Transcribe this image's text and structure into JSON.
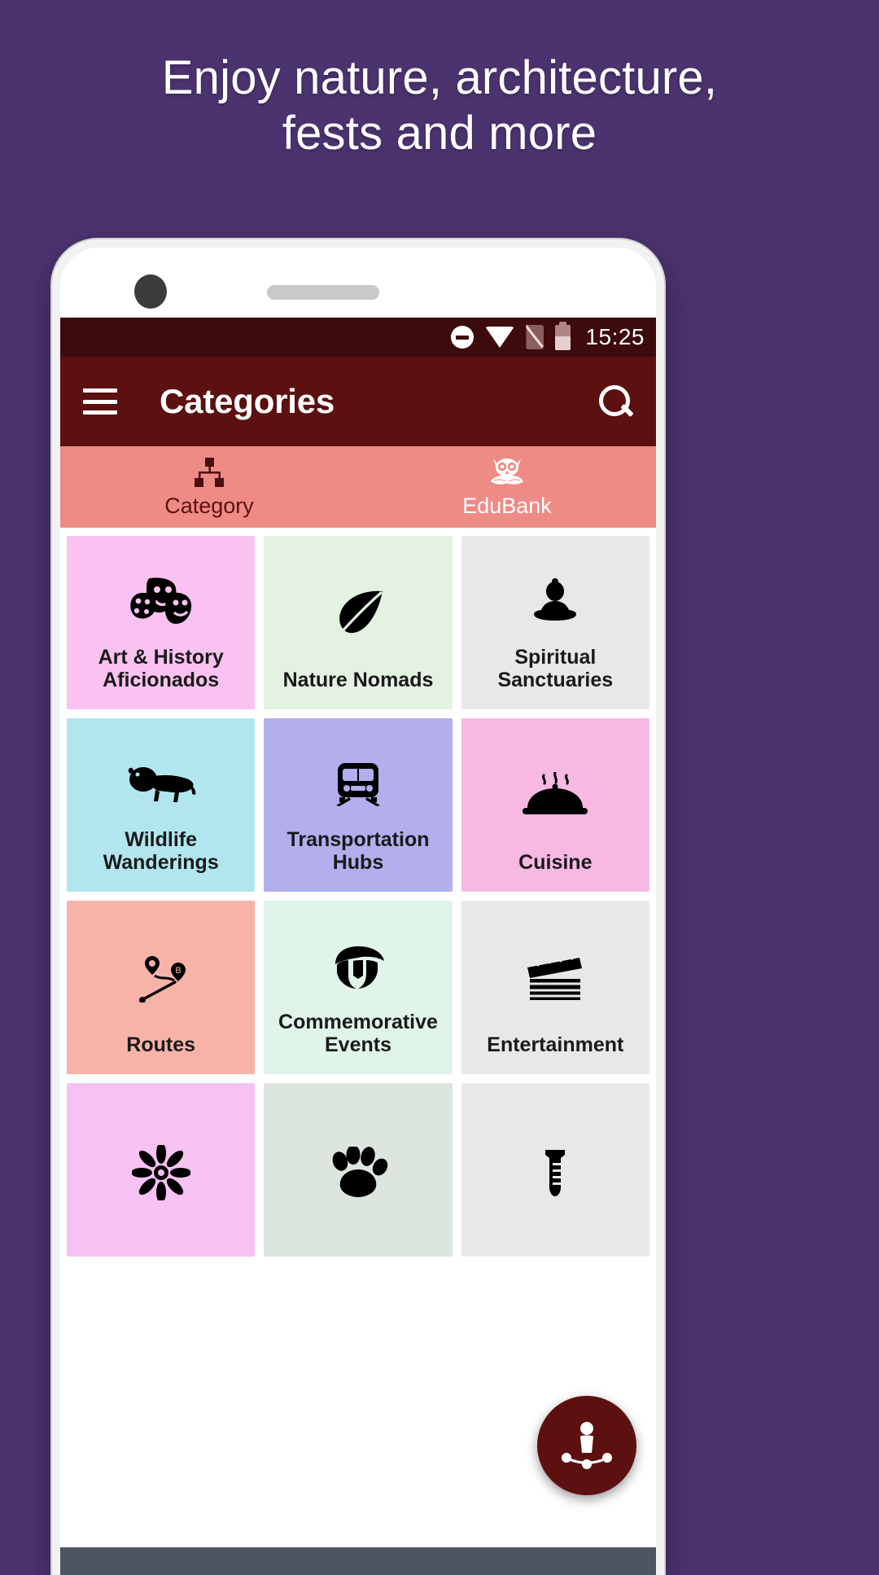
{
  "promo": {
    "headline": "Enjoy nature, architecture,\nfests and more",
    "background_color": "#4b3370",
    "headline_color": "#ffffff"
  },
  "statusbar": {
    "time": "15:25",
    "icons": [
      "do-not-disturb-icon",
      "wifi-icon",
      "sim-off-icon",
      "battery-icon"
    ]
  },
  "appbar": {
    "title": "Categories",
    "menu_icon": "hamburger-menu-icon",
    "search_icon": "search-icon",
    "background_color": "#5c1010"
  },
  "tabs": {
    "background_color": "#ef8b85",
    "items": [
      {
        "label": "Category",
        "icon": "sitemap-icon",
        "active": true
      },
      {
        "label": "EduBank",
        "icon": "owl-book-icon",
        "active": false
      }
    ]
  },
  "grid": {
    "cards": [
      {
        "label": "Art & History Aficionados",
        "icon": "theater-masks-palette-icon",
        "color": "#f9c2f0"
      },
      {
        "label": "Nature Nomads",
        "icon": "leaf-icon",
        "color": "#e4f2e2"
      },
      {
        "label": "Spiritual Sanctuaries",
        "icon": "buddha-icon",
        "color": "#e8e8e8"
      },
      {
        "label": "Wildlife Wanderings",
        "icon": "lion-icon",
        "color": "#b2e6ef"
      },
      {
        "label": "Transportation Hubs",
        "icon": "train-icon",
        "color": "#b3aeee"
      },
      {
        "label": "Cuisine",
        "icon": "food-dome-icon",
        "color": "#f7b8e2"
      },
      {
        "label": "Routes",
        "icon": "route-map-icon",
        "color": "#f8b3a8"
      },
      {
        "label": "Commemorative Events",
        "icon": "spartan-helmet-icon",
        "color": "#e0f4ea"
      },
      {
        "label": "Entertainment",
        "icon": "clapperboard-icon",
        "color": "#e8e8e8"
      },
      {
        "label": "",
        "icon": "flower-icon",
        "color": "#f6c2f2"
      },
      {
        "label": "",
        "icon": "paw-print-icon",
        "color": "#dde6de"
      },
      {
        "label": "",
        "icon": "science-beaker-icon",
        "color": "#e8e8e8"
      }
    ]
  },
  "fab": {
    "icon": "community-person-icon",
    "color": "#5c1010"
  }
}
